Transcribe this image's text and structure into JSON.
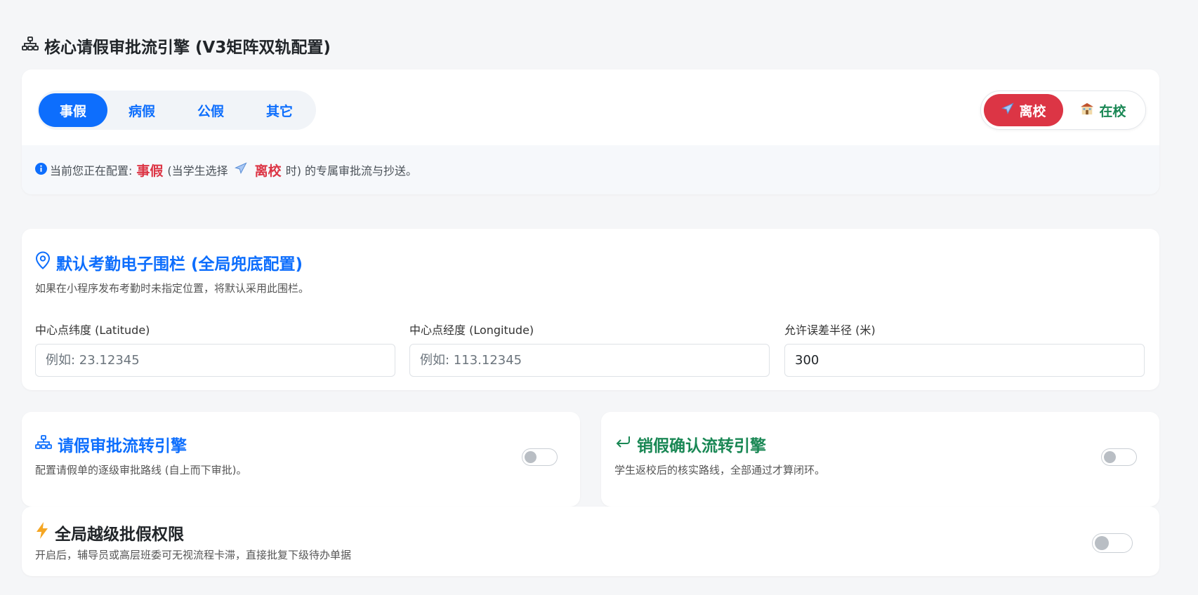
{
  "page": {
    "title": "核心请假审批流引擎 (V3矩阵双轨配置)",
    "title_icon": "sitemap-icon"
  },
  "leave_types": [
    {
      "label": "事假",
      "active": true
    },
    {
      "label": "病假",
      "active": false
    },
    {
      "label": "公假",
      "active": false
    },
    {
      "label": "其它",
      "active": false
    }
  ],
  "location_toggle": {
    "leave_label": "离校",
    "leave_icon": "airplane-icon",
    "stay_label": "在校",
    "stay_icon": "school-icon",
    "selected": "leave"
  },
  "info": {
    "prefix": "当前您正在配置:",
    "type": "事假",
    "mid": "(当学生选择",
    "location": "离校",
    "suffix": "时) 的专属审批流与抄送。"
  },
  "geofence": {
    "title": "默认考勤电子围栏 (全局兜底配置)",
    "desc": "如果在小程序发布考勤时未指定位置，将默认采用此围栏。",
    "lat_label": "中心点纬度 (Latitude)",
    "lat_placeholder": "例如: 23.12345",
    "lng_label": "中心点经度 (Longitude)",
    "lng_placeholder": "例如: 113.12345",
    "radius_label": "允许误差半径 (米)",
    "radius_value": "300"
  },
  "approval_flow": {
    "title": "请假审批流转引擎",
    "desc": "配置请假单的逐级审批路线 (自上而下审批)。",
    "enabled": false
  },
  "cancel_flow": {
    "title": "销假确认流转引擎",
    "desc": "学生返校后的核实路线，全部通过才算闭环。",
    "enabled": false
  },
  "override": {
    "title": "全局越级批假权限",
    "desc": "开启后，辅导员或高层班委可无视流程卡滞，直接批复下级待办单据",
    "enabled": false
  },
  "colors": {
    "primary": "#0d6efd",
    "danger": "#dc3545",
    "success": "#198754",
    "bolt": "#f5a623"
  }
}
